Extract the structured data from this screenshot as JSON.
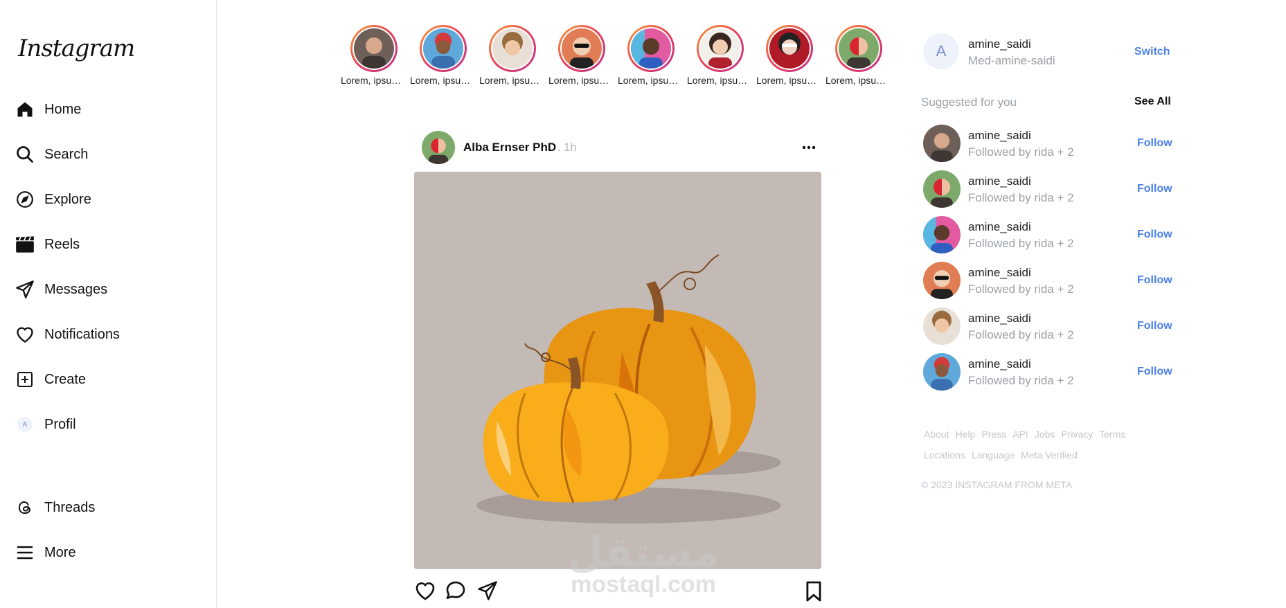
{
  "sidebar": {
    "logo": "Instagram",
    "items": [
      {
        "label": "Home",
        "icon": "home-icon"
      },
      {
        "label": "Search",
        "icon": "search-icon"
      },
      {
        "label": "Explore",
        "icon": "compass-icon"
      },
      {
        "label": "Reels",
        "icon": "reels-icon"
      },
      {
        "label": "Messages",
        "icon": "paper-plane-icon"
      },
      {
        "label": "Notifications",
        "icon": "heart-icon"
      },
      {
        "label": "Create",
        "icon": "plus-square-icon"
      },
      {
        "label": "Profil",
        "icon": "avatar"
      }
    ],
    "profile_initial": "A",
    "bottom_items": [
      {
        "label": "Threads",
        "icon": "threads-icon"
      },
      {
        "label": "More",
        "icon": "menu-icon"
      }
    ]
  },
  "stories": [
    {
      "label": "Lorem, ipsum dolor"
    },
    {
      "label": "Lorem, ipsum dolor"
    },
    {
      "label": "Lorem, ipsum dolor"
    },
    {
      "label": "Lorem, ipsum dolor"
    },
    {
      "label": "Lorem, ipsum dolor"
    },
    {
      "label": "Lorem, ipsum dolor"
    },
    {
      "label": "Lorem, ipsum dolor"
    },
    {
      "label": "Lorem, ipsum dolor"
    }
  ],
  "post": {
    "username": "Alba Ernser PhD",
    "separator": ".",
    "time": "1h",
    "image_subject": "two orange pumpkins illustration",
    "actions": [
      "heart-icon",
      "comment-icon",
      "share-icon",
      "bookmark-icon"
    ]
  },
  "right": {
    "current_user": {
      "initial": "A",
      "username": "amine_saidi",
      "full_name": "Med-amine-saidi",
      "switch_label": "Switch"
    },
    "suggested_title": "Suggested for you",
    "see_all_label": "See All",
    "suggestions": [
      {
        "username": "amine_saidi",
        "subtitle": "Followed by rida + 2",
        "action": "Follow"
      },
      {
        "username": "amine_saidi",
        "subtitle": "Followed by rida + 2",
        "action": "Follow"
      },
      {
        "username": "amine_saidi",
        "subtitle": "Followed by rida + 2",
        "action": "Follow"
      },
      {
        "username": "amine_saidi",
        "subtitle": "Followed by rida + 2",
        "action": "Follow"
      },
      {
        "username": "amine_saidi",
        "subtitle": "Followed by rida + 2",
        "action": "Follow"
      },
      {
        "username": "amine_saidi",
        "subtitle": "Followed by rida + 2",
        "action": "Follow"
      }
    ],
    "footer_links": [
      "About",
      "Help",
      "Press",
      "API",
      "Jobs",
      "Privacy",
      "Terms",
      "Locations",
      "Language",
      "Meta Verified"
    ],
    "copyright": "© 2023 INSTAGRAM FROM META"
  },
  "watermark": {
    "arabic": "مستقل",
    "latin": "mostaql.com"
  },
  "colors": {
    "accent": "#4a80e8",
    "muted": "#9aa0a6",
    "story_ring_start": "#f7a23b",
    "story_ring_end": "#c0328e",
    "post_bg": "#c3bab6"
  }
}
